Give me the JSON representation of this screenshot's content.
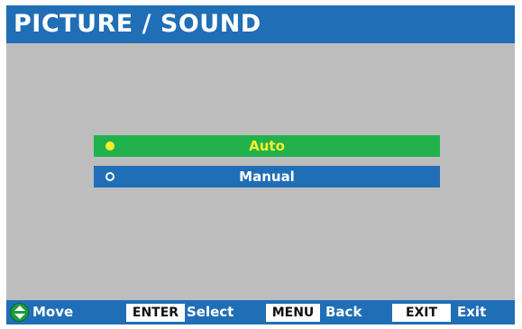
{
  "header": {
    "title": "PICTURE / SOUND"
  },
  "options": [
    {
      "label": "Auto",
      "selected": true
    },
    {
      "label": "Manual",
      "selected": false
    }
  ],
  "footer": {
    "move_label": "Move",
    "enter_key": "ENTER",
    "select_label": "Select",
    "menu_key": "MENU",
    "back_label": "Back",
    "exit_key": "EXIT",
    "exit_label": "Exit"
  },
  "colors": {
    "title_bar": "#1f6eb6",
    "background": "#bdbdbd",
    "selected_option": "#22b24c",
    "selected_text": "#ffee2a",
    "unselected_option": "#1f6eb6"
  },
  "icons": {
    "move": "up-down-arrows-icon",
    "selected_radio": "radio-filled-icon",
    "unselected_radio": "radio-empty-icon"
  }
}
